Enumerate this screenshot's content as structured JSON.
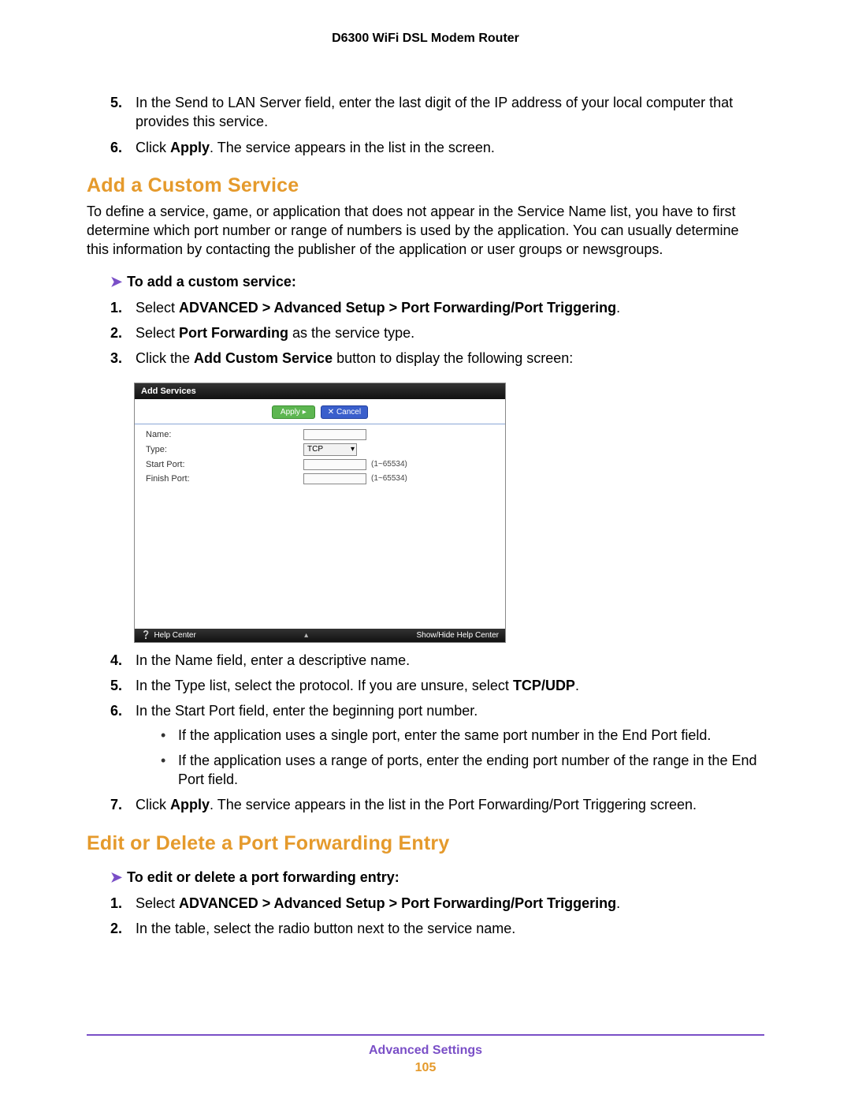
{
  "header": {
    "product": "D6300 WiFi DSL Modem Router"
  },
  "intro": {
    "step5_num": "5.",
    "step5_text": "In the Send to LAN Server field, enter the last digit of the IP address of your local computer that provides this service.",
    "step6_num": "6.",
    "step6_pre": "Click ",
    "step6_bold": "Apply",
    "step6_post": ". The service appears in the list in the screen."
  },
  "section1": {
    "heading": "Add a Custom Service",
    "para": "To define a service, game, or application that does not appear in the Service Name list, you have to first determine which port number or range of numbers is used by the application. You can usually determine this information by contacting the publisher of the application or user groups or newsgroups.",
    "subhead": "To add a custom service:",
    "s1_num": "1.",
    "s1_pre": "Select ",
    "s1_bold": "ADVANCED > Advanced Setup > Port Forwarding/Port Triggering",
    "s1_post": ".",
    "s2_num": "2.",
    "s2_pre": "Select ",
    "s2_bold": "Port Forwarding",
    "s2_post": " as the service type.",
    "s3_num": "3.",
    "s3_pre": "Click the ",
    "s3_bold": "Add Custom Service",
    "s3_post": " button to display the following screen:",
    "s4_num": "4.",
    "s4_text": "In the Name field, enter a descriptive name.",
    "s5_num": "5.",
    "s5_pre": "In the Type list, select the protocol. If you are unsure, select ",
    "s5_bold": "TCP/UDP",
    "s5_post": ".",
    "s6_num": "6.",
    "s6_text": "In the Start Port field, enter the beginning port number.",
    "b1": "If the application uses a single port, enter the same port number in the End Port field.",
    "b2": "If the application uses a range of ports, enter the ending port number of the range in the End Port field.",
    "s7_num": "7.",
    "s7_pre": "Click ",
    "s7_bold": "Apply",
    "s7_post": ". The service appears in the list in the Port Forwarding/Port Triggering screen."
  },
  "panel": {
    "title": "Add Services",
    "apply": "Apply  ▸",
    "cancel": "✕ Cancel",
    "name_label": "Name:",
    "type_label": "Type:",
    "type_value": "TCP",
    "startport_label": "Start Port:",
    "finishport_label": "Finish Port:",
    "range_hint": "(1~65534)",
    "help_center": "Help Center",
    "show_hide": "Show/Hide Help Center"
  },
  "section2": {
    "heading": "Edit or Delete a Port Forwarding Entry",
    "subhead": "To edit or delete a port forwarding entry:",
    "s1_num": "1.",
    "s1_pre": "Select ",
    "s1_bold": "ADVANCED > Advanced Setup > Port Forwarding/Port Triggering",
    "s1_post": ".",
    "s2_num": "2.",
    "s2_text": "In the table, select the radio button next to the service name."
  },
  "footer": {
    "label": "Advanced Settings",
    "page": "105"
  }
}
